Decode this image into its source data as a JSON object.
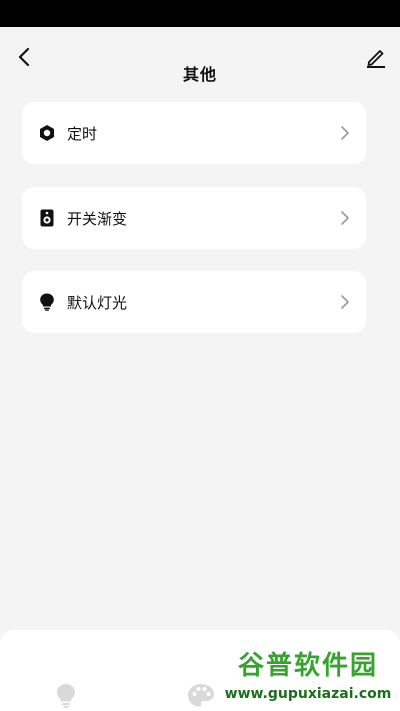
{
  "header": {
    "title": "其他",
    "back_icon": "chevron-left-icon",
    "edit_icon": "pencil-icon"
  },
  "menu": {
    "items": [
      {
        "label": "定时",
        "icon": "hexagon-timer-icon"
      },
      {
        "label": "开关渐变",
        "icon": "speaker-icon"
      },
      {
        "label": "默认灯光",
        "icon": "bulb-icon"
      }
    ],
    "chevron_icon": "chevron-right-icon"
  },
  "bottom_tabs": [
    {
      "icon": "bulb-icon"
    },
    {
      "icon": "palette-icon"
    }
  ],
  "watermark": {
    "title": "谷普软件园",
    "url": "www.gupuxiazai.com"
  },
  "colors": {
    "background": "#f4f4f4",
    "card": "#ffffff",
    "text": "#111111",
    "chevron": "#9a9a9a",
    "watermark_green": "#37a32f"
  }
}
